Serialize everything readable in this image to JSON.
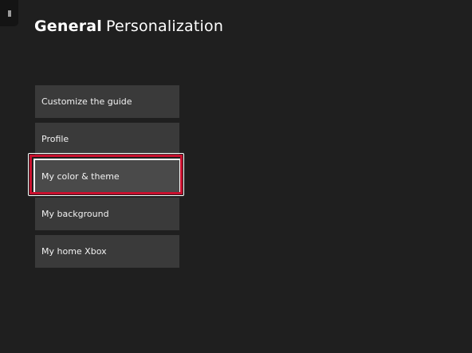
{
  "header": {
    "section": "General",
    "page": "Personalization"
  },
  "corner_tab": {
    "icon": "grip-dots-icon"
  },
  "menu": {
    "items": [
      {
        "label": "Customize the guide"
      },
      {
        "label": "Profile"
      },
      {
        "label": "My color & theme",
        "focused": true
      },
      {
        "label": "My background"
      },
      {
        "label": "My home Xbox"
      }
    ]
  },
  "annotation": {
    "highlight_color": "#c8102e",
    "highlighted_item": "My color & theme"
  }
}
